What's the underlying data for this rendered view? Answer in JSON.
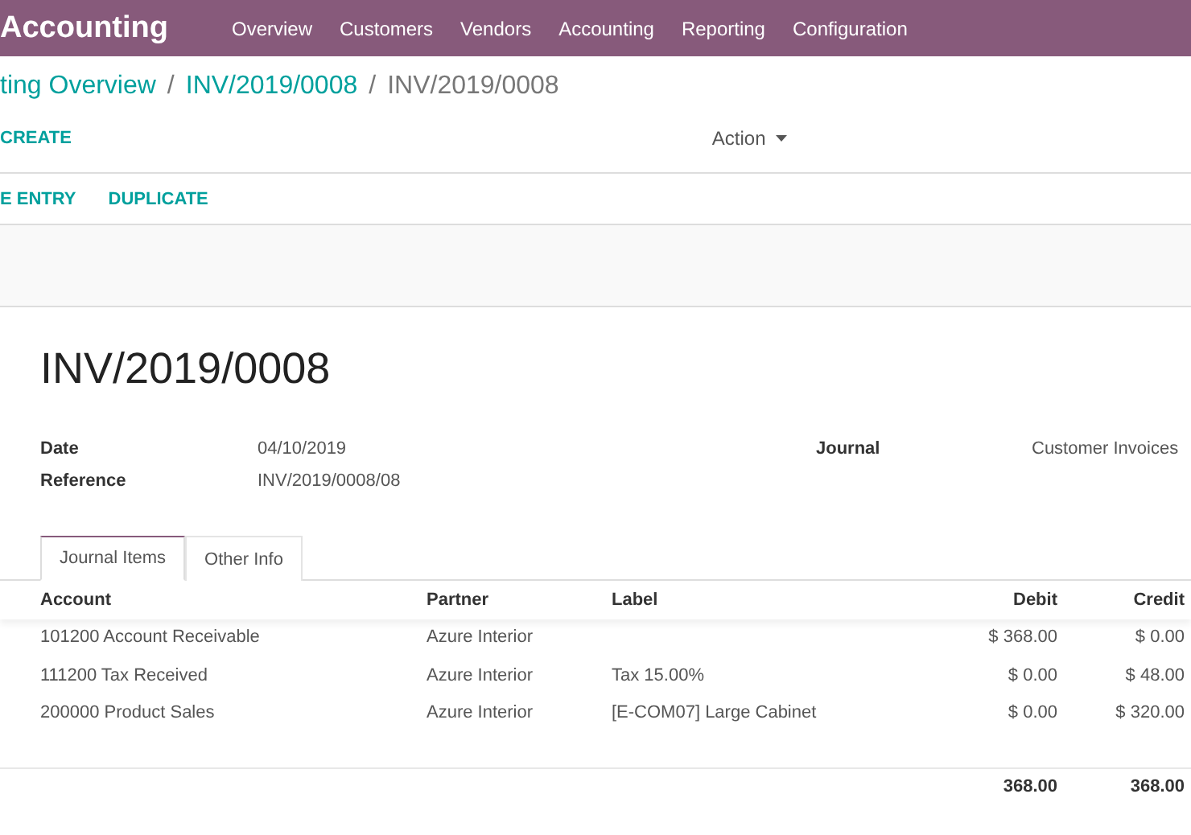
{
  "app_title": "Accounting",
  "nav": [
    "Overview",
    "Customers",
    "Vendors",
    "Accounting",
    "Reporting",
    "Configuration"
  ],
  "breadcrumb_separator": "/",
  "breadcrumb": [
    {
      "label": "ting Overview",
      "link": true
    },
    {
      "label": "INV/2019/0008",
      "link": true
    },
    {
      "label": "INV/2019/0008",
      "link": false
    }
  ],
  "create_button": "CREATE",
  "action_menu": "Action",
  "toolbar_buttons": [
    "E ENTRY",
    "DUPLICATE"
  ],
  "record_title": "INV/2019/0008",
  "fields_left": [
    {
      "label": "Date",
      "value": "04/10/2019"
    },
    {
      "label": "Reference",
      "value": "INV/2019/0008/08"
    }
  ],
  "fields_right": [
    {
      "label": "Journal",
      "value": "Customer Invoices"
    }
  ],
  "tabs": [
    {
      "label": "Journal Items",
      "selected": true
    },
    {
      "label": "Other Info",
      "selected": false
    }
  ],
  "table": {
    "columns": [
      "Account",
      "Partner",
      "Label",
      "Debit",
      "Credit"
    ],
    "rows": [
      [
        "101200 Account Receivable",
        "Azure Interior",
        "",
        "$ 368.00",
        "$ 0.00"
      ],
      [
        "111200 Tax Received",
        "Azure Interior",
        "Tax 15.00%",
        "$ 0.00",
        "$ 48.00"
      ],
      [
        "200000 Product Sales",
        "Azure Interior",
        "[E-COM07] Large Cabinet",
        "$ 0.00",
        "$ 320.00"
      ]
    ],
    "totals": [
      "368.00",
      "368.00"
    ]
  }
}
